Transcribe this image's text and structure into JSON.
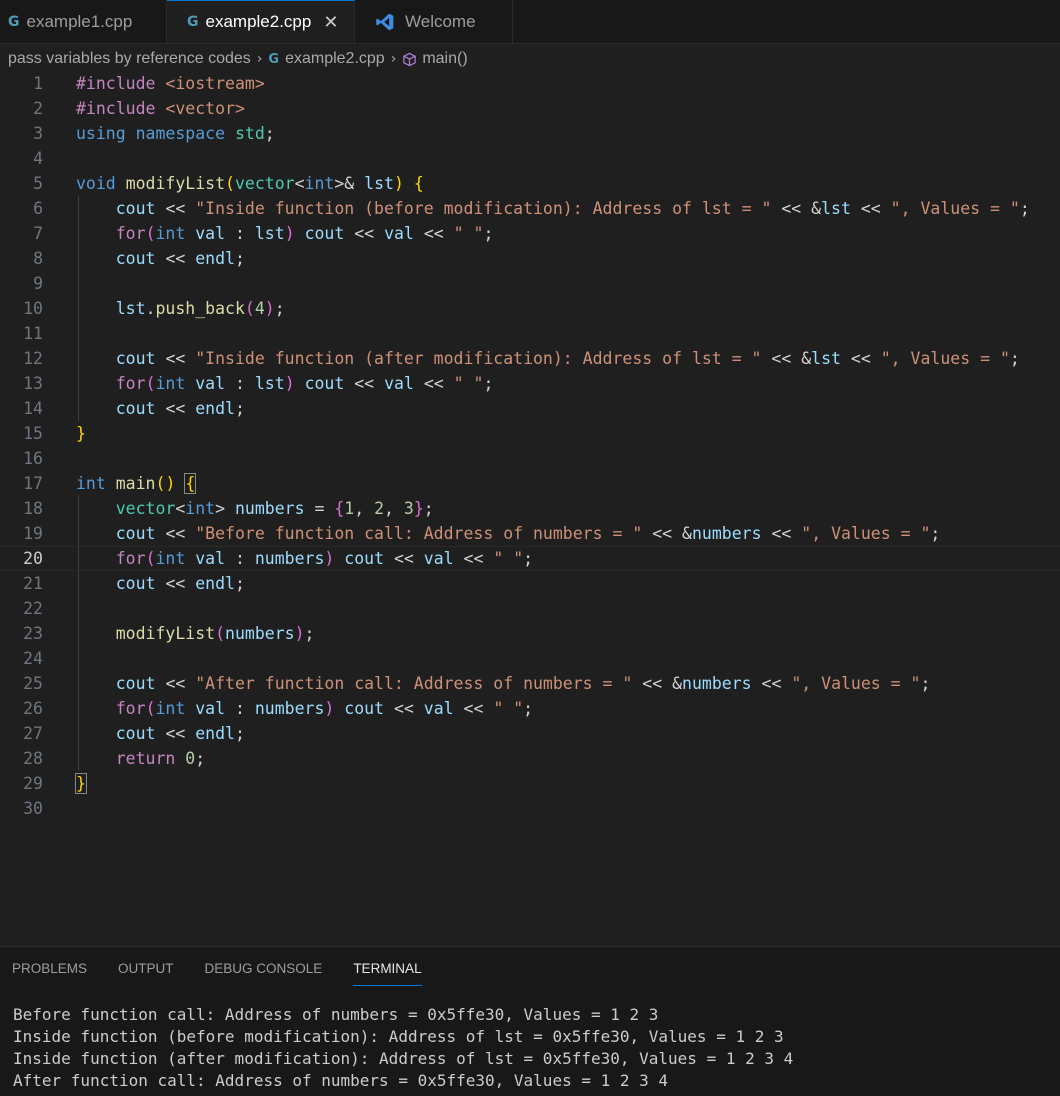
{
  "tabs": [
    {
      "icon": "c++-file-icon",
      "label": "example1.cpp",
      "active": false
    },
    {
      "icon": "c++-file-icon",
      "label": "example2.cpp",
      "active": true,
      "close": "✕"
    },
    {
      "icon": "vscode-logo-icon",
      "label": "Welcome",
      "active": false
    }
  ],
  "breadcrumb": {
    "folder": "pass variables by reference codes",
    "file": "example2.cpp",
    "symbol": "main()"
  },
  "editor": {
    "current_line": 20,
    "line_numbers": [
      "1",
      "2",
      "3",
      "4",
      "5",
      "6",
      "7",
      "8",
      "9",
      "10",
      "11",
      "12",
      "13",
      "14",
      "15",
      "16",
      "17",
      "18",
      "19",
      "20",
      "21",
      "22",
      "23",
      "24",
      "25",
      "26",
      "27",
      "28",
      "29",
      "30"
    ],
    "lines": [
      "#include <iostream>",
      "#include <vector>",
      "using namespace std;",
      "",
      "void modifyList(vector<int>& lst) {",
      "    cout << \"Inside function (before modification): Address of lst = \" << &lst << \", Values = \";",
      "    for(int val : lst) cout << val << \" \";",
      "    cout << endl;",
      "",
      "    lst.push_back(4);",
      "",
      "    cout << \"Inside function (after modification): Address of lst = \" << &lst << \", Values = \";",
      "    for(int val : lst) cout << val << \" \";",
      "    cout << endl;",
      "}",
      "",
      "int main() {",
      "    vector<int> numbers = {1, 2, 3};",
      "    cout << \"Before function call: Address of numbers = \" << &numbers << \", Values = \";",
      "    for(int val : numbers) cout << val << \" \";",
      "    cout << endl;",
      "",
      "    modifyList(numbers);",
      "",
      "    cout << \"After function call: Address of numbers = \" << &numbers << \", Values = \";",
      "    for(int val : numbers) cout << val << \" \";",
      "    cout << endl;",
      "    return 0;",
      "}",
      ""
    ]
  },
  "panel": {
    "tabs": [
      "PROBLEMS",
      "OUTPUT",
      "DEBUG CONSOLE",
      "TERMINAL"
    ],
    "active_tab": "TERMINAL",
    "terminal_lines": [
      "Before function call: Address of numbers = 0x5ffe30, Values = 1 2 3",
      "Inside function (before modification): Address of lst = 0x5ffe30, Values = 1 2 3",
      "Inside function (after modification): Address of lst = 0x5ffe30, Values = 1 2 3 4",
      "After function call: Address of numbers = 0x5ffe30, Values = 1 2 3 4"
    ]
  },
  "colors": {
    "keyword": "#569cd6",
    "control": "#c586c0",
    "function": "#dcdcaa",
    "type": "#4ec9b0",
    "variable": "#9cdcfe",
    "string": "#ce9178",
    "number": "#b5cea8",
    "accent": "#0078d4"
  }
}
